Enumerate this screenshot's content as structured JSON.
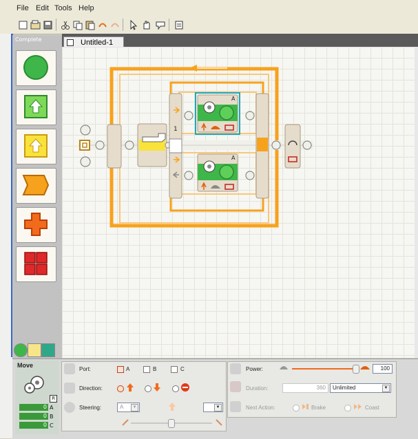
{
  "menu": [
    "File",
    "Edit",
    "Tools",
    "Help"
  ],
  "palette": {
    "title": "Complete",
    "items": [
      "common-blocks",
      "action-blocks",
      "sensor-blocks",
      "flow-blocks",
      "data-blocks",
      "advanced-blocks"
    ]
  },
  "document_tab": {
    "label": "Untitled-1"
  },
  "program": {
    "switch_label": "1",
    "top_block_port": "A",
    "bottom_block_port": "A"
  },
  "block_info": {
    "title": "Move",
    "reset_label": "R",
    "ports": [
      {
        "value": "0",
        "letter": "A"
      },
      {
        "value": "0",
        "letter": "B"
      },
      {
        "value": "0",
        "letter": "C"
      }
    ]
  },
  "config": {
    "port_label": "Port:",
    "port_options": [
      {
        "label": "A",
        "checked": true
      },
      {
        "label": "B",
        "checked": false
      },
      {
        "label": "C",
        "checked": false
      }
    ],
    "direction_label": "Direction:",
    "steering_label": "Steering:",
    "steering_left": "A",
    "power_label": "Power:",
    "power_value": "100",
    "power_fraction": 1.0,
    "duration_label": "Duration:",
    "duration_value": "360",
    "duration_unit": "Unlimited",
    "next_action_label": "Next Action:",
    "brake_label": "Brake",
    "coast_label": "Coast"
  },
  "colors": {
    "accent": "#f7a21c",
    "green": "#39b54a",
    "canvas": "#f6f6f2"
  }
}
